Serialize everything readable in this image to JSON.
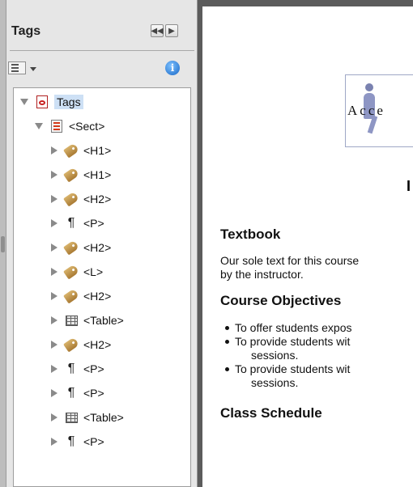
{
  "panel": {
    "title": "Tags",
    "info_glyph": "i",
    "icons": [
      "collapse-left-icon",
      "expand-right-icon",
      "options-menu-icon",
      "info-icon"
    ]
  },
  "tree": {
    "root": {
      "label": "Tags",
      "icon": "pdf-document-icon"
    },
    "sect": {
      "label": "<Sect>",
      "icon": "section-icon"
    },
    "children": [
      {
        "label": "<H1>",
        "icon": "tag-icon"
      },
      {
        "label": "<H1>",
        "icon": "tag-icon"
      },
      {
        "label": "<H2>",
        "icon": "tag-icon"
      },
      {
        "label": "<P>",
        "icon": "paragraph-icon"
      },
      {
        "label": "<H2>",
        "icon": "tag-icon"
      },
      {
        "label": "<L>",
        "icon": "tag-icon"
      },
      {
        "label": "<H2>",
        "icon": "tag-icon"
      },
      {
        "label": "<Table>",
        "icon": "table-icon"
      },
      {
        "label": "<H2>",
        "icon": "tag-icon"
      },
      {
        "label": "<P>",
        "icon": "paragraph-icon"
      },
      {
        "label": "<P>",
        "icon": "paragraph-icon"
      },
      {
        "label": "<Table>",
        "icon": "table-icon"
      },
      {
        "label": "<P>",
        "icon": "paragraph-icon"
      }
    ]
  },
  "document": {
    "logo_text": "Acce",
    "heading_fragment": "I",
    "textbook_heading": "Textbook",
    "textbook_line1": "Our sole text for this course",
    "textbook_line2": "by the instructor.",
    "objectives_heading": "Course Objectives",
    "bullet1": "To offer students expos",
    "bullet2": "To provide students wit",
    "bullet2_cont": "sessions.",
    "bullet3": "To provide students wit",
    "bullet3_cont": "sessions.",
    "schedule_heading": "Class Schedule"
  },
  "colors": {
    "selection": "#cde0f5",
    "panel_bg": "#e6e6e6",
    "pdf_red": "#c82020",
    "tag_tan": "#c29a55"
  }
}
